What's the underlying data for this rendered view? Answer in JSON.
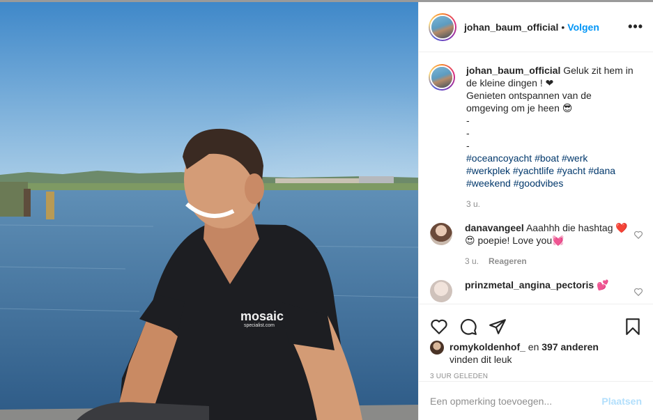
{
  "post": {
    "username": "johan_baum_official",
    "follow_label": "Volgen",
    "separator": "•",
    "more_label": "•••"
  },
  "photo": {
    "shirt_text_line1": "mosaic",
    "shirt_text_line2": "specialist.com"
  },
  "caption": {
    "username": "johan_baum_official",
    "line1": "Geluk zit hem in de kleine dingen ! ❤",
    "line2": "Genieten ontspannen van de omgeving om je heen 😎",
    "dash1": "-",
    "dash2": "-",
    "dash3": "-",
    "hashtags": [
      "#oceancoyacht",
      "#boat",
      "#werk",
      "#werkplek",
      "#yachtlife",
      "#yacht",
      "#dana",
      "#weekend",
      "#goodvibes"
    ],
    "time": "3 u."
  },
  "comments": [
    {
      "username": "danavangeel",
      "text": "Aaahhh die hashtag ❤️😍 poepie! Love you💓",
      "time": "3 u.",
      "reply_label": "Reageren"
    },
    {
      "username": "prinzmetal_angina_pectoris",
      "text": "💕"
    }
  ],
  "likes": {
    "user": "romykoldenhof_",
    "middle": "en",
    "count": "397 anderen",
    "suffix": "vinden dit leuk"
  },
  "timestamp": "3 UUR GELEDEN",
  "add_comment": {
    "placeholder": "Een opmerking toevoegen...",
    "post_label": "Plaatsen"
  },
  "colors": {
    "link": "#0095f6",
    "hashtag": "#00376b",
    "muted": "#8e8e8e",
    "post_disabled": "#b2dffc"
  },
  "icons": [
    "heart-icon",
    "comment-icon",
    "share-icon",
    "bookmark-icon"
  ]
}
